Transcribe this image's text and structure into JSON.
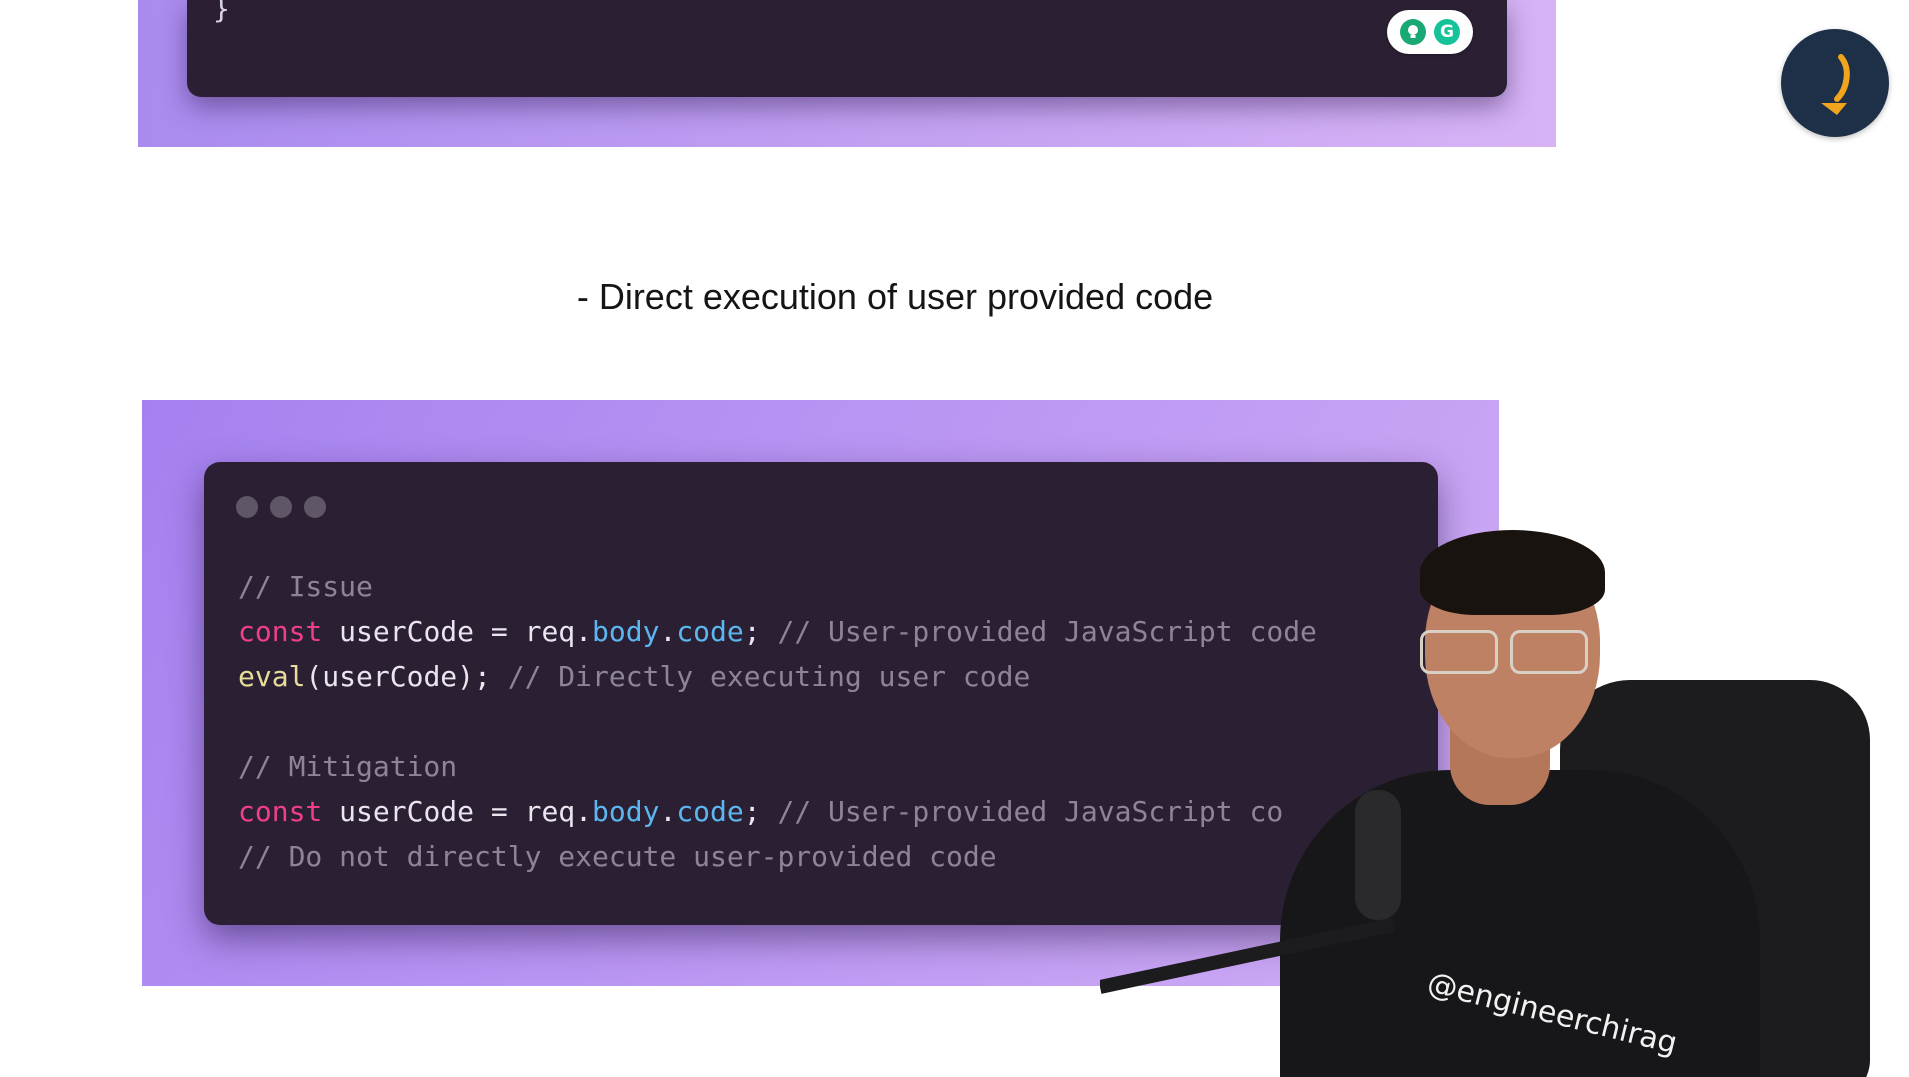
{
  "top_panel": {
    "visible_code": "}",
    "extension": {
      "icons": [
        "lightbulb-icon",
        "grammarly-icon"
      ],
      "grammarly_label": "G"
    }
  },
  "channel_logo": {
    "icon": "channel-logo-icon",
    "colors": {
      "background": "#1e2f48",
      "accent": "#f0a51c"
    }
  },
  "heading": "- Direct execution of user provided code",
  "code_window": {
    "lines": [
      [
        {
          "text": "// Issue",
          "type": "comment"
        }
      ],
      [
        {
          "text": "const",
          "type": "keyword"
        },
        {
          "text": " userCode = req.",
          "type": "ident"
        },
        {
          "text": "body",
          "type": "prop"
        },
        {
          "text": ".",
          "type": "ident"
        },
        {
          "text": "code",
          "type": "prop"
        },
        {
          "text": "; ",
          "type": "ident"
        },
        {
          "text": "// User-provided JavaScript code",
          "type": "comment"
        }
      ],
      [
        {
          "text": "eval",
          "type": "func"
        },
        {
          "text": "(userCode); ",
          "type": "ident"
        },
        {
          "text": "// Directly executing user code",
          "type": "comment"
        }
      ],
      [
        {
          "text": "",
          "type": "ident"
        }
      ],
      [
        {
          "text": "// Mitigation",
          "type": "comment"
        }
      ],
      [
        {
          "text": "const",
          "type": "keyword"
        },
        {
          "text": " userCode = req.",
          "type": "ident"
        },
        {
          "text": "body",
          "type": "prop"
        },
        {
          "text": ".",
          "type": "ident"
        },
        {
          "text": "code",
          "type": "prop"
        },
        {
          "text": "; ",
          "type": "ident"
        },
        {
          "text": "// User-provided JavaScript co",
          "type": "comment"
        }
      ],
      [
        {
          "text": "// Do not directly execute user-provided code",
          "type": "comment"
        }
      ]
    ],
    "colors": {
      "background": "#2b2033",
      "keyword": "#f03e8a",
      "property": "#5cb6f0",
      "function": "#e6dd9a",
      "comment": "#8e8499"
    }
  },
  "webcam": {
    "shirt_text": "@engineerchirag"
  }
}
